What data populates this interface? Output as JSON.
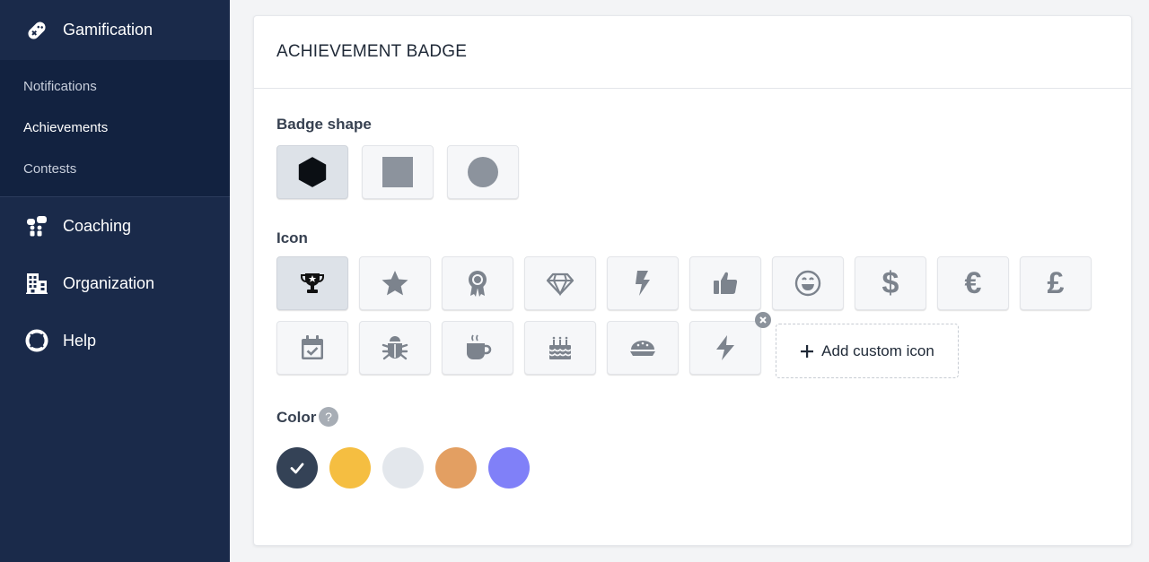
{
  "sidebar": {
    "top_item": {
      "label": "Gamification",
      "icon": "gamepad-icon"
    },
    "sub_items": [
      {
        "label": "Notifications"
      },
      {
        "label": "Achievements",
        "active": true
      },
      {
        "label": "Contests"
      }
    ],
    "items": [
      {
        "label": "Coaching",
        "icon": "coaching-icon"
      },
      {
        "label": "Organization",
        "icon": "building-icon"
      },
      {
        "label": "Help",
        "icon": "lifebuoy-icon"
      }
    ]
  },
  "card": {
    "title": "ACHIEVEMENT BADGE",
    "badge_shape": {
      "label": "Badge shape",
      "options": [
        "hexagon-shape-icon",
        "square-shape-icon",
        "circle-shape-icon"
      ],
      "selected": "hexagon-shape-icon"
    },
    "icon_section": {
      "label": "Icon",
      "icons_row1": [
        "trophy-icon",
        "star-icon",
        "award-ribbon-icon",
        "gem-icon",
        "bolt-icon",
        "thumbs-up-icon",
        "smile-icon",
        "dollar-icon",
        "euro-icon",
        "pound-icon"
      ],
      "icons_row2": [
        "calendar-check-icon",
        "bug-icon",
        "coffee-icon",
        "birthday-cake-icon",
        "pie-icon",
        "custom-bolt-icon"
      ],
      "selected": "trophy-icon",
      "add_custom_label": "Add custom icon",
      "dollar_glyph": "$",
      "euro_glyph": "€",
      "pound_glyph": "£"
    },
    "color_section": {
      "label": "Color",
      "help_glyph": "?",
      "swatches": [
        "#344256",
        "#f5be41",
        "#e3e7ec",
        "#e39f62",
        "#8080f8"
      ],
      "selected": "#344256"
    }
  },
  "colors": {
    "sidebar_bg": "#1a2a4a",
    "subnav_bg": "#122240",
    "icon_gray": "#7c838d"
  }
}
